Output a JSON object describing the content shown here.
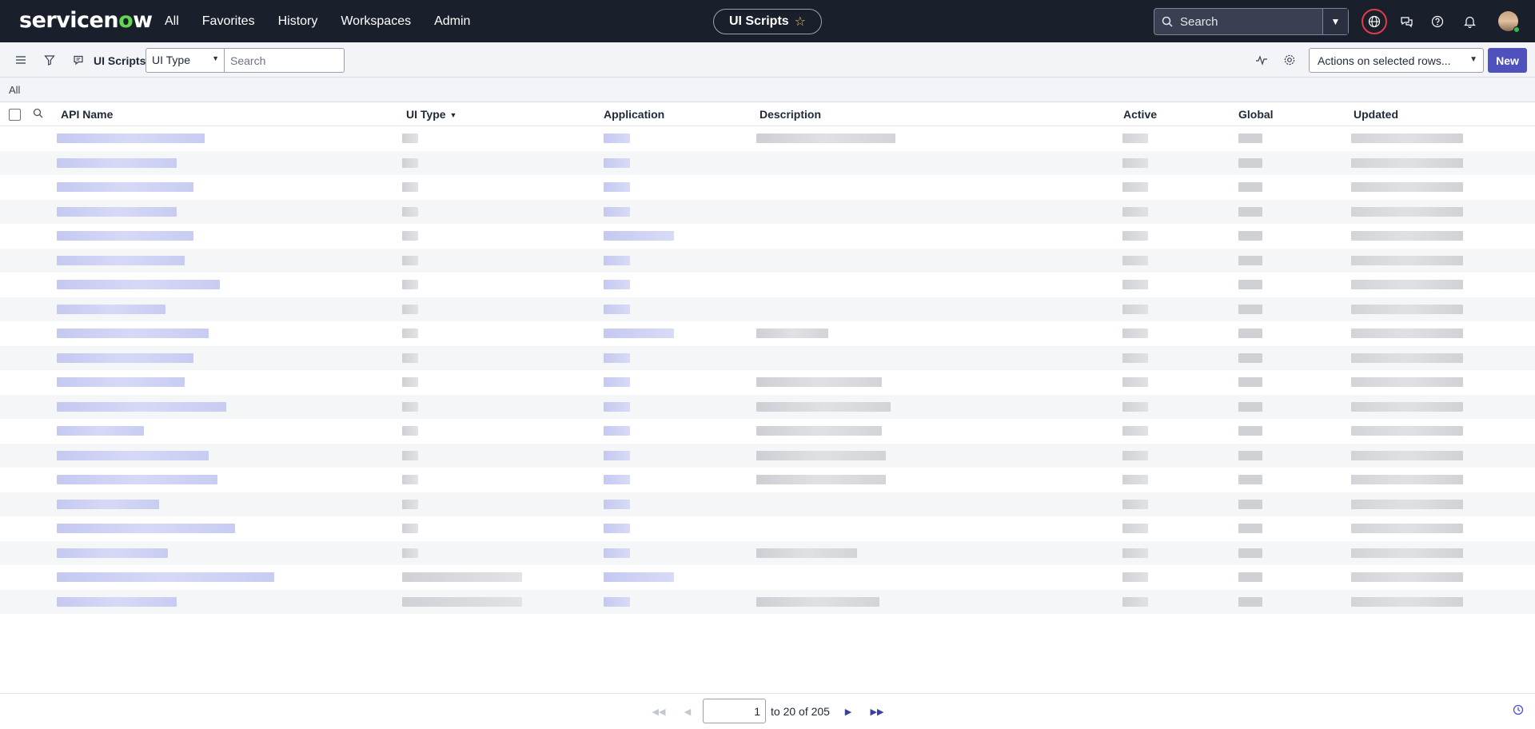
{
  "topnav": {
    "logo": {
      "prefix": "servicen",
      "o": "o",
      "suffix": "w"
    },
    "links": [
      "All",
      "Favorites",
      "History",
      "Workspaces",
      "Admin"
    ],
    "page_title": "UI Scripts",
    "search_placeholder": "Search"
  },
  "toolbar": {
    "list_title": "UI Scripts",
    "field_select": "UI Type",
    "search_placeholder": "Search",
    "actions_label": "Actions on selected rows...",
    "new_label": "New"
  },
  "breadcrumb": "All",
  "table": {
    "columns": [
      "API Name",
      "UI Type",
      "Application",
      "Description",
      "Active",
      "Global",
      "Updated"
    ],
    "rows": [
      {
        "api": 0.68,
        "type": 0.13,
        "app": 0.3,
        "desc": 0.62,
        "active": true
      },
      {
        "api": 0.55,
        "type": 0.13,
        "app": 0.3,
        "desc": 0,
        "active": true
      },
      {
        "api": 0.63,
        "type": 0.13,
        "app": 0.3,
        "desc": 0,
        "active": true
      },
      {
        "api": 0.55,
        "type": 0.13,
        "app": 0.3,
        "desc": 0,
        "active": true
      },
      {
        "api": 0.63,
        "type": 0.13,
        "app": 0.8,
        "desc": 0,
        "active": true
      },
      {
        "api": 0.59,
        "type": 0.13,
        "app": 0.3,
        "desc": 0,
        "active": true
      },
      {
        "api": 0.75,
        "type": 0.13,
        "app": 0.3,
        "desc": 0,
        "active": true
      },
      {
        "api": 0.5,
        "type": 0.13,
        "app": 0.3,
        "desc": 0,
        "active": true
      },
      {
        "api": 0.7,
        "type": 0.13,
        "app": 0.8,
        "desc": 0.32,
        "active": true
      },
      {
        "api": 0.63,
        "type": 0.13,
        "app": 0.3,
        "desc": 0,
        "active": true
      },
      {
        "api": 0.59,
        "type": 0.13,
        "app": 0.3,
        "desc": 0.56,
        "active": true
      },
      {
        "api": 0.78,
        "type": 0.13,
        "app": 0.3,
        "desc": 0.6,
        "active": true
      },
      {
        "api": 0.4,
        "type": 0.13,
        "app": 0.3,
        "desc": 0.56,
        "active": true
      },
      {
        "api": 0.7,
        "type": 0.13,
        "app": 0.3,
        "desc": 0.58,
        "active": true
      },
      {
        "api": 0.74,
        "type": 0.13,
        "app": 0.3,
        "desc": 0.58,
        "active": true
      },
      {
        "api": 0.47,
        "type": 0.13,
        "app": 0.3,
        "desc": 0,
        "active": true
      },
      {
        "api": 0.82,
        "type": 0.13,
        "app": 0.3,
        "desc": 0,
        "active": true
      },
      {
        "api": 0.51,
        "type": 0.13,
        "app": 0.3,
        "desc": 0.45,
        "active": true
      },
      {
        "api": 1.0,
        "type": 1.0,
        "app": 0.8,
        "desc": 0,
        "active": true
      },
      {
        "api": 0.55,
        "type": 1.0,
        "app": 0.3,
        "desc": 0.55,
        "active": true
      }
    ]
  },
  "pagination": {
    "current_page": "1",
    "range_text": "to 20 of 205"
  },
  "icons": {
    "hamburger": "hamburger-icon",
    "filter": "filter-icon",
    "comment": "comment-icon",
    "globe": "globe-icon",
    "chat": "chat-icon",
    "help": "help-icon",
    "bell": "bell-icon",
    "activity": "activity-icon",
    "gear": "gear-icon"
  },
  "colors": {
    "nav_bg": "#1a1f2c",
    "accent": "#4f52bd",
    "logo_green": "#62d84e",
    "globe_ring": "#e23d4a"
  }
}
